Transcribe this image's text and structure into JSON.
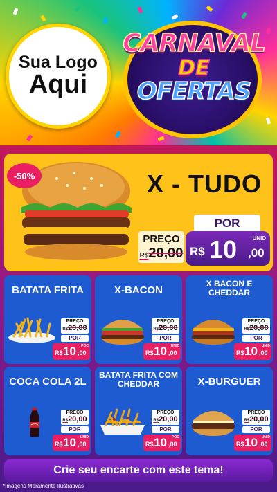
{
  "header": {
    "logo_line1": "Sua Logo",
    "logo_line2": "Aqui",
    "title_line1": "CARNAVAL",
    "title_line2": "DE",
    "title_line3": "OFERTAS"
  },
  "featured": {
    "badge": "-50%",
    "name": "X - TUDO",
    "preco_label": "PREÇO",
    "old_currency": "R$",
    "old_price": "20,00",
    "por_label": "POR",
    "currency": "R$",
    "price_int": "10",
    "price_cents": ",00",
    "unit": "UNID"
  },
  "products": [
    {
      "name": "BATATA FRITA",
      "preco_label": "PREÇO",
      "old_currency": "R$",
      "old_price": "20,00",
      "por_label": "POR",
      "currency": "R$",
      "price_int": "10",
      "price_cents": ",00",
      "unit": "POC"
    },
    {
      "name": "X-BACON",
      "preco_label": "PREÇO",
      "old_currency": "R$",
      "old_price": "20,00",
      "por_label": "POR",
      "currency": "R$",
      "price_int": "10",
      "price_cents": ",00",
      "unit": "UNID"
    },
    {
      "name": "X BACON E CHEDDAR",
      "preco_label": "PREÇO",
      "old_currency": "R$",
      "old_price": "20,00",
      "por_label": "POR",
      "currency": "R$",
      "price_int": "10",
      "price_cents": ",00",
      "unit": "UNID"
    },
    {
      "name": "COCA COLA 2L",
      "preco_label": "PREÇO",
      "old_currency": "R$",
      "old_price": "20,00",
      "por_label": "POR",
      "currency": "R$",
      "price_int": "10",
      "price_cents": ",00",
      "unit": "UNID"
    },
    {
      "name": "BATATA FRITA COM CHEDDAR",
      "preco_label": "PREÇO",
      "old_currency": "R$",
      "old_price": "20,00",
      "por_label": "POR",
      "currency": "R$",
      "price_int": "10",
      "price_cents": ",00",
      "unit": "POC"
    },
    {
      "name": "X-BURGUER",
      "preco_label": "PREÇO",
      "old_currency": "R$",
      "old_price": "20,00",
      "por_label": "POR",
      "currency": "R$",
      "price_int": "10",
      "price_cents": ",00",
      "unit": "UNID"
    }
  ],
  "footer": {
    "cta": "Crie seu encarte com este tema!",
    "disclaimer": "*Imagens Meramente Ilustrativas"
  },
  "colors": {
    "card_blue": "#1e5bd1",
    "featured_yellow": "#ffc21a",
    "price_pink": "#e91e63",
    "price_purple": "#5a1aa0"
  },
  "icons": {
    "featured_image": "burger-icon",
    "card_images": [
      "fries-icon",
      "burger-icon",
      "burger-icon",
      "soda-bottle-icon",
      "cheese-fries-icon",
      "burger-icon"
    ]
  }
}
